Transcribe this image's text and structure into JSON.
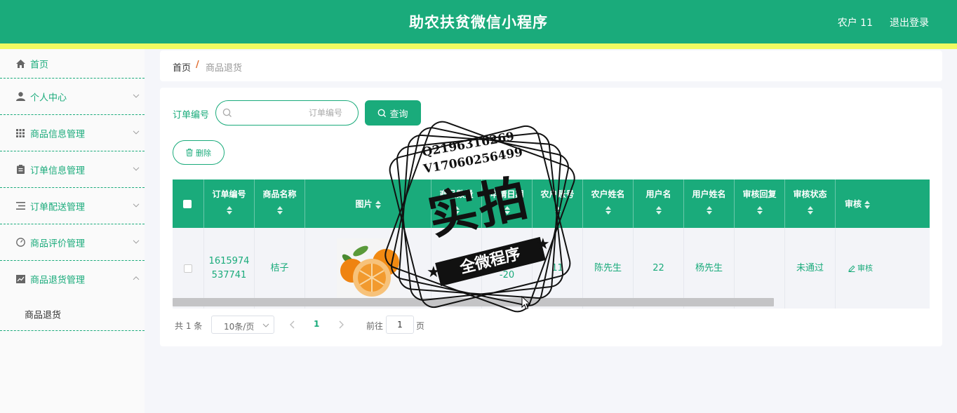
{
  "header": {
    "title": "助农扶贫微信小程序",
    "user": "农户 11",
    "logout": "退出登录"
  },
  "sidebar": {
    "items": [
      {
        "label": "首页",
        "icon": "home-icon"
      },
      {
        "label": "个人中心",
        "icon": "user-icon"
      },
      {
        "label": "商品信息管理",
        "icon": "grid-icon"
      },
      {
        "label": "订单信息管理",
        "icon": "clipboard-icon"
      },
      {
        "label": "订单配送管理",
        "icon": "list-icon"
      },
      {
        "label": "商品评价管理",
        "icon": "gauge-icon"
      },
      {
        "label": "商品退货管理",
        "icon": "chart-icon"
      }
    ],
    "sub_item": "商品退货"
  },
  "breadcrumb": {
    "home": "首页",
    "separator": "/",
    "current": "商品退货"
  },
  "search": {
    "label": "订单编号",
    "placeholder": "订单编号",
    "value": "",
    "button": "查询"
  },
  "actions": {
    "delete": "删除"
  },
  "table": {
    "headers": [
      "订单编号",
      "商品名称",
      "图片",
      "商品数量",
      "申请日期",
      "农户账号",
      "农户姓名",
      "用户名",
      "用户姓名",
      "审核回复",
      "审核状态",
      "审核"
    ],
    "rows": [
      {
        "order_no": "1615974537741",
        "order_no_line1": "1615974",
        "order_no_line2": "537741",
        "product": "桔子",
        "image": "orange-image",
        "extra": "nul",
        "date_line1": "2021-03",
        "date_line2": "-20",
        "farmer_account": "11",
        "farmer_name": "陈先生",
        "username": "22",
        "user_realname": "杨先生",
        "reply": "",
        "status": "未通过",
        "action": "审核"
      }
    ]
  },
  "pagination": {
    "total": "共 1 条",
    "page_size": "10条/页",
    "current": "1",
    "goto": "前往",
    "jump_value": "1",
    "page_unit": "页"
  },
  "watermark": {
    "qq": "Q2196316269",
    "vx": "V17060256499",
    "main": "实拍",
    "ribbon": "全微程序"
  },
  "colors": {
    "primary": "#1aab7b",
    "accent": "#f0fa61"
  }
}
